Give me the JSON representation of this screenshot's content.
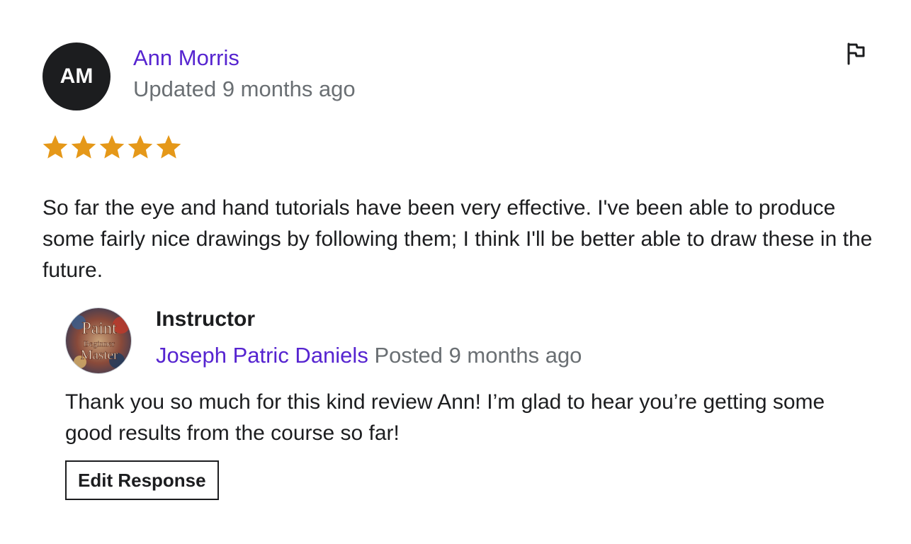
{
  "review": {
    "avatar_initials": "AM",
    "reviewer_name": "Ann Morris",
    "meta": "Updated 9 months ago",
    "rating": 5,
    "rating_max": 5,
    "star_color": "#e59819",
    "flag_icon": "flag-icon",
    "body": "So far the eye and hand tutorials have been very effective. I've been able to produce some fairly nice drawings by following them; I think I'll be better able to draw these in the future."
  },
  "response": {
    "avatar_text": [
      "Paint",
      "Beginner",
      "Master"
    ],
    "role": "Instructor",
    "instructor_name": "Joseph Patric Daniels",
    "posted": "Posted 9 months ago",
    "body": "Thank you so much for this kind review Ann! I’m glad to hear you’re getting some good results from the course so far!",
    "edit_label": "Edit Response"
  },
  "colors": {
    "link": "#5624d0",
    "muted": "#6a6f73",
    "text": "#1c1d1f"
  }
}
